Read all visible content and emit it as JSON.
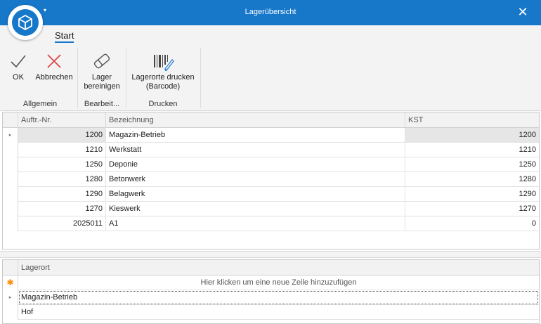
{
  "window": {
    "title": "Lagerübersicht",
    "close_glyph": "✕",
    "qat_glyph": "▾",
    "accent": "#1777c9"
  },
  "ribbon": {
    "tab": "Start",
    "buttons": {
      "ok": "OK",
      "cancel": "Abbrechen",
      "clean_line1": "Lager",
      "clean_line2": "bereinigen",
      "print_line1": "Lagerorte drucken",
      "print_line2": "(Barcode)"
    },
    "groups": {
      "general": "Allgemein",
      "edit": "Bearbeit...",
      "print": "Drucken"
    }
  },
  "grid1": {
    "columns": [
      "Auftr.-Nr.",
      "Bezeichnung",
      "KST"
    ],
    "rows": [
      {
        "nr": "1200",
        "name": "Magazin-Betrieb",
        "kst": "1200"
      },
      {
        "nr": "1210",
        "name": "Werkstatt",
        "kst": "1210"
      },
      {
        "nr": "1250",
        "name": "Deponie",
        "kst": "1250"
      },
      {
        "nr": "1280",
        "name": "Betonwerk",
        "kst": "1280"
      },
      {
        "nr": "1290",
        "name": "Belagwerk",
        "kst": "1290"
      },
      {
        "nr": "1270",
        "name": "Kieswerk",
        "kst": "1270"
      },
      {
        "nr": "2025011",
        "name": "A1",
        "kst": "0"
      }
    ],
    "row_indicator": "▸"
  },
  "grid2": {
    "columns": [
      "Lagerort"
    ],
    "new_row_text": "Hier klicken um eine neue Zeile hinzuzufügen",
    "new_row_glyph": "✱",
    "rows": [
      "Magazin-Betrieb",
      "Hof"
    ],
    "row_indicator": "▸"
  }
}
